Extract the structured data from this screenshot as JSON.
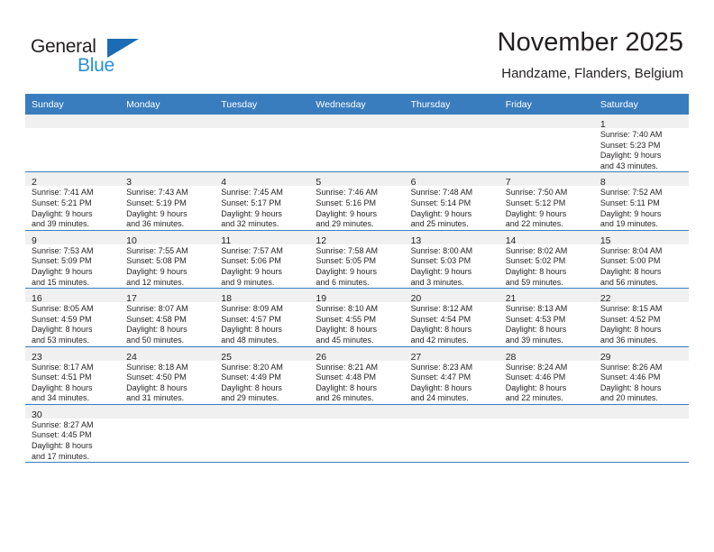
{
  "brand": {
    "name_part1": "General",
    "name_part2": "Blue",
    "accent_color": "#1b6cb5",
    "accent_light": "#2a8fd4"
  },
  "header": {
    "title": "November 2025",
    "subtitle": "Handzame, Flanders, Belgium"
  },
  "theme": {
    "header_row_bg": "#3a7dbf",
    "daynum_strip_bg": "#f0f0f0",
    "text_color": "#231f20"
  },
  "weekdays": [
    "Sunday",
    "Monday",
    "Tuesday",
    "Wednesday",
    "Thursday",
    "Friday",
    "Saturday"
  ],
  "weeks": [
    [
      {
        "day": "",
        "lines": []
      },
      {
        "day": "",
        "lines": []
      },
      {
        "day": "",
        "lines": []
      },
      {
        "day": "",
        "lines": []
      },
      {
        "day": "",
        "lines": []
      },
      {
        "day": "",
        "lines": []
      },
      {
        "day": "1",
        "lines": [
          "Sunrise: 7:40 AM",
          "Sunset: 5:23 PM",
          "Daylight: 9 hours",
          "and 43 minutes."
        ]
      }
    ],
    [
      {
        "day": "2",
        "lines": [
          "Sunrise: 7:41 AM",
          "Sunset: 5:21 PM",
          "Daylight: 9 hours",
          "and 39 minutes."
        ]
      },
      {
        "day": "3",
        "lines": [
          "Sunrise: 7:43 AM",
          "Sunset: 5:19 PM",
          "Daylight: 9 hours",
          "and 36 minutes."
        ]
      },
      {
        "day": "4",
        "lines": [
          "Sunrise: 7:45 AM",
          "Sunset: 5:17 PM",
          "Daylight: 9 hours",
          "and 32 minutes."
        ]
      },
      {
        "day": "5",
        "lines": [
          "Sunrise: 7:46 AM",
          "Sunset: 5:16 PM",
          "Daylight: 9 hours",
          "and 29 minutes."
        ]
      },
      {
        "day": "6",
        "lines": [
          "Sunrise: 7:48 AM",
          "Sunset: 5:14 PM",
          "Daylight: 9 hours",
          "and 25 minutes."
        ]
      },
      {
        "day": "7",
        "lines": [
          "Sunrise: 7:50 AM",
          "Sunset: 5:12 PM",
          "Daylight: 9 hours",
          "and 22 minutes."
        ]
      },
      {
        "day": "8",
        "lines": [
          "Sunrise: 7:52 AM",
          "Sunset: 5:11 PM",
          "Daylight: 9 hours",
          "and 19 minutes."
        ]
      }
    ],
    [
      {
        "day": "9",
        "lines": [
          "Sunrise: 7:53 AM",
          "Sunset: 5:09 PM",
          "Daylight: 9 hours",
          "and 15 minutes."
        ]
      },
      {
        "day": "10",
        "lines": [
          "Sunrise: 7:55 AM",
          "Sunset: 5:08 PM",
          "Daylight: 9 hours",
          "and 12 minutes."
        ]
      },
      {
        "day": "11",
        "lines": [
          "Sunrise: 7:57 AM",
          "Sunset: 5:06 PM",
          "Daylight: 9 hours",
          "and 9 minutes."
        ]
      },
      {
        "day": "12",
        "lines": [
          "Sunrise: 7:58 AM",
          "Sunset: 5:05 PM",
          "Daylight: 9 hours",
          "and 6 minutes."
        ]
      },
      {
        "day": "13",
        "lines": [
          "Sunrise: 8:00 AM",
          "Sunset: 5:03 PM",
          "Daylight: 9 hours",
          "and 3 minutes."
        ]
      },
      {
        "day": "14",
        "lines": [
          "Sunrise: 8:02 AM",
          "Sunset: 5:02 PM",
          "Daylight: 8 hours",
          "and 59 minutes."
        ]
      },
      {
        "day": "15",
        "lines": [
          "Sunrise: 8:04 AM",
          "Sunset: 5:00 PM",
          "Daylight: 8 hours",
          "and 56 minutes."
        ]
      }
    ],
    [
      {
        "day": "16",
        "lines": [
          "Sunrise: 8:05 AM",
          "Sunset: 4:59 PM",
          "Daylight: 8 hours",
          "and 53 minutes."
        ]
      },
      {
        "day": "17",
        "lines": [
          "Sunrise: 8:07 AM",
          "Sunset: 4:58 PM",
          "Daylight: 8 hours",
          "and 50 minutes."
        ]
      },
      {
        "day": "18",
        "lines": [
          "Sunrise: 8:09 AM",
          "Sunset: 4:57 PM",
          "Daylight: 8 hours",
          "and 48 minutes."
        ]
      },
      {
        "day": "19",
        "lines": [
          "Sunrise: 8:10 AM",
          "Sunset: 4:55 PM",
          "Daylight: 8 hours",
          "and 45 minutes."
        ]
      },
      {
        "day": "20",
        "lines": [
          "Sunrise: 8:12 AM",
          "Sunset: 4:54 PM",
          "Daylight: 8 hours",
          "and 42 minutes."
        ]
      },
      {
        "day": "21",
        "lines": [
          "Sunrise: 8:13 AM",
          "Sunset: 4:53 PM",
          "Daylight: 8 hours",
          "and 39 minutes."
        ]
      },
      {
        "day": "22",
        "lines": [
          "Sunrise: 8:15 AM",
          "Sunset: 4:52 PM",
          "Daylight: 8 hours",
          "and 36 minutes."
        ]
      }
    ],
    [
      {
        "day": "23",
        "lines": [
          "Sunrise: 8:17 AM",
          "Sunset: 4:51 PM",
          "Daylight: 8 hours",
          "and 34 minutes."
        ]
      },
      {
        "day": "24",
        "lines": [
          "Sunrise: 8:18 AM",
          "Sunset: 4:50 PM",
          "Daylight: 8 hours",
          "and 31 minutes."
        ]
      },
      {
        "day": "25",
        "lines": [
          "Sunrise: 8:20 AM",
          "Sunset: 4:49 PM",
          "Daylight: 8 hours",
          "and 29 minutes."
        ]
      },
      {
        "day": "26",
        "lines": [
          "Sunrise: 8:21 AM",
          "Sunset: 4:48 PM",
          "Daylight: 8 hours",
          "and 26 minutes."
        ]
      },
      {
        "day": "27",
        "lines": [
          "Sunrise: 8:23 AM",
          "Sunset: 4:47 PM",
          "Daylight: 8 hours",
          "and 24 minutes."
        ]
      },
      {
        "day": "28",
        "lines": [
          "Sunrise: 8:24 AM",
          "Sunset: 4:46 PM",
          "Daylight: 8 hours",
          "and 22 minutes."
        ]
      },
      {
        "day": "29",
        "lines": [
          "Sunrise: 8:26 AM",
          "Sunset: 4:46 PM",
          "Daylight: 8 hours",
          "and 20 minutes."
        ]
      }
    ],
    [
      {
        "day": "30",
        "lines": [
          "Sunrise: 8:27 AM",
          "Sunset: 4:45 PM",
          "Daylight: 8 hours",
          "and 17 minutes."
        ]
      },
      {
        "day": "",
        "lines": []
      },
      {
        "day": "",
        "lines": []
      },
      {
        "day": "",
        "lines": []
      },
      {
        "day": "",
        "lines": []
      },
      {
        "day": "",
        "lines": []
      },
      {
        "day": "",
        "lines": []
      }
    ]
  ]
}
